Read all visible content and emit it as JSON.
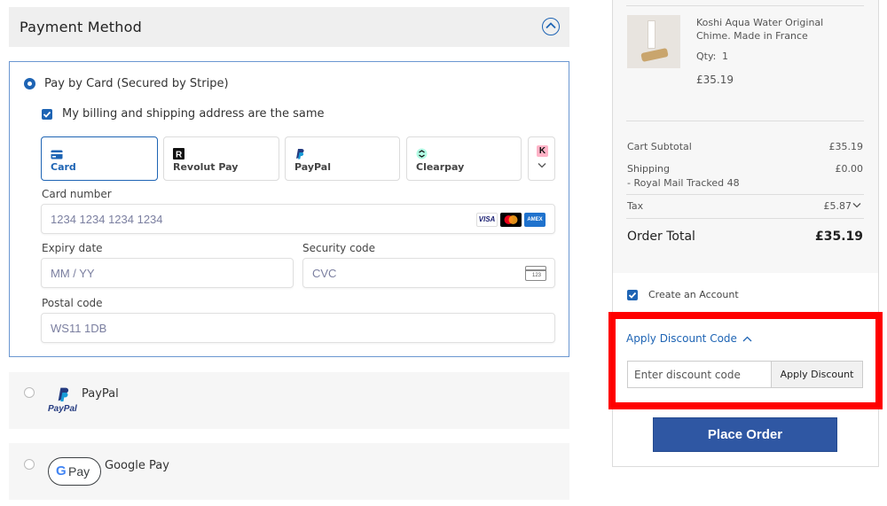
{
  "payment": {
    "header_title": "Payment Method",
    "card_option_label": "Pay by Card (Secured by Stripe)",
    "billing_same_label": "My billing and shipping address are the same",
    "tabs": [
      {
        "label": "Card",
        "icon": "card-icon"
      },
      {
        "label": "Revolut Pay",
        "icon": "revolut-icon"
      },
      {
        "label": "PayPal",
        "icon": "paypal-icon"
      },
      {
        "label": "Clearpay",
        "icon": "clearpay-icon"
      },
      {
        "label": "K",
        "icon": "klarna-icon"
      }
    ],
    "fields": {
      "card_number_label": "Card number",
      "card_number_placeholder": "1234 1234 1234 1234",
      "expiry_label": "Expiry date",
      "expiry_placeholder": "MM / YY",
      "cvc_label": "Security code",
      "cvc_placeholder": "CVC",
      "cvc_badge": "123",
      "postal_label": "Postal code",
      "postal_value": "WS11 1DB"
    },
    "card_brands": [
      "VISA",
      "AMEX"
    ],
    "alt_options": {
      "paypal_label": "PayPal",
      "paypal_logo_text": "PayPal",
      "google_label": "Google Pay",
      "gpay_logo_text": "Pay"
    }
  },
  "summary": {
    "product_name_line1": "Koshi Aqua Water Original",
    "product_name_line2": "Chime. Made in France",
    "qty_label": "Qty:",
    "qty_value": "1",
    "product_price": "£35.19",
    "subtotal_label": "Cart Subtotal",
    "subtotal_value": "£35.19",
    "shipping_label": "Shipping",
    "shipping_method": "- Royal Mail Tracked 48",
    "shipping_value": "£0.00",
    "tax_label": "Tax",
    "tax_value": "£5.87",
    "total_label": "Order Total",
    "total_value": "£35.19",
    "create_account_label": "Create an Account",
    "discount_toggle_label": "Apply Discount Code",
    "discount_placeholder": "Enter discount code",
    "apply_discount_label": "Apply Discount",
    "place_order_label": "Place Order"
  },
  "colors": {
    "accent": "#1e64b4",
    "place_order_bg": "#2f57a3",
    "highlight": "#ff0000",
    "header_bg": "#efefef"
  }
}
